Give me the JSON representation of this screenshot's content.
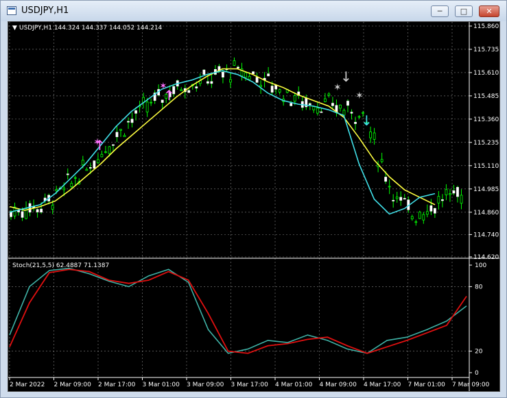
{
  "window": {
    "title": "USDJPY,H1",
    "buttons": {
      "minimize_icon": "minimize-icon",
      "maximize_icon": "maximize-icon",
      "close_icon": "close-icon"
    }
  },
  "main_chart": {
    "header": "USDJPY,H1  144.324 144.337 144.052 144.214",
    "price_labels": [
      "115.860",
      "115.735",
      "115.610",
      "115.485",
      "115.360",
      "115.235",
      "115.110",
      "114.985",
      "114.860",
      "114.740",
      "114.620"
    ]
  },
  "indicator": {
    "header": "Stoch(21,5,5) 62.4887 71.1387",
    "levels": [
      "100",
      "80",
      "20",
      "0"
    ]
  },
  "time_labels": [
    "2 Mar 2022",
    "2 Mar 09:00",
    "2 Mar 17:00",
    "3 Mar 01:00",
    "3 Mar 09:00",
    "3 Mar 17:00",
    "4 Mar 01:00",
    "4 Mar 09:00",
    "4 Mar 17:00",
    "7 Mar 01:00",
    "7 Mar 09:00"
  ],
  "colors": {
    "background": "#000000",
    "bull": "#00ff00",
    "bear": "#ffffff",
    "fast_ma": "#40e0e8",
    "slow_ma": "#ffff40",
    "stoch_main": "#3fb2a6",
    "stoch_signal": "#e01010"
  },
  "chart_data": [
    {
      "type": "line",
      "title": "USDJPY,H1",
      "series": [
        {
          "name": "",
          "values": [
            114.86,
            114.88,
            114.9,
            114.96,
            115.04,
            115.12,
            115.22,
            115.32,
            115.4,
            115.46,
            115.52,
            115.55,
            115.57,
            115.6,
            115.62,
            115.6,
            115.56,
            115.5,
            115.46,
            115.44,
            115.43,
            115.41,
            115.38,
            115.12,
            114.93,
            114.85,
            114.88,
            114.94,
            114.96
          ]
        },
        {
          "name": "",
          "values": [
            114.89,
            114.87,
            114.89,
            114.92,
            114.98,
            115.05,
            115.12,
            115.2,
            115.27,
            115.34,
            115.41,
            115.48,
            115.54,
            115.59,
            115.63,
            115.63,
            115.6,
            115.56,
            115.53,
            115.49,
            115.46,
            115.43,
            115.37,
            115.26,
            115.14,
            115.05,
            114.98,
            114.94,
            114.9
          ]
        }
      ],
      "ylim": [
        114.62,
        115.86
      ]
    },
    {
      "type": "line",
      "title": "Stoch(21,5,5) 62.4887 71.1387",
      "series": [
        {
          "name": "",
          "values": [
            35,
            80,
            95,
            97,
            92,
            85,
            80,
            90,
            96,
            84,
            40,
            18,
            22,
            30,
            28,
            35,
            30,
            22,
            18,
            30,
            33,
            40,
            48,
            62
          ]
        },
        {
          "name": "",
          "values": [
            24,
            65,
            93,
            96,
            94,
            86,
            83,
            86,
            94,
            86,
            55,
            20,
            18,
            25,
            27,
            31,
            33,
            25,
            18,
            24,
            30,
            37,
            44,
            71
          ]
        }
      ],
      "ylim": [
        0,
        100
      ]
    }
  ]
}
